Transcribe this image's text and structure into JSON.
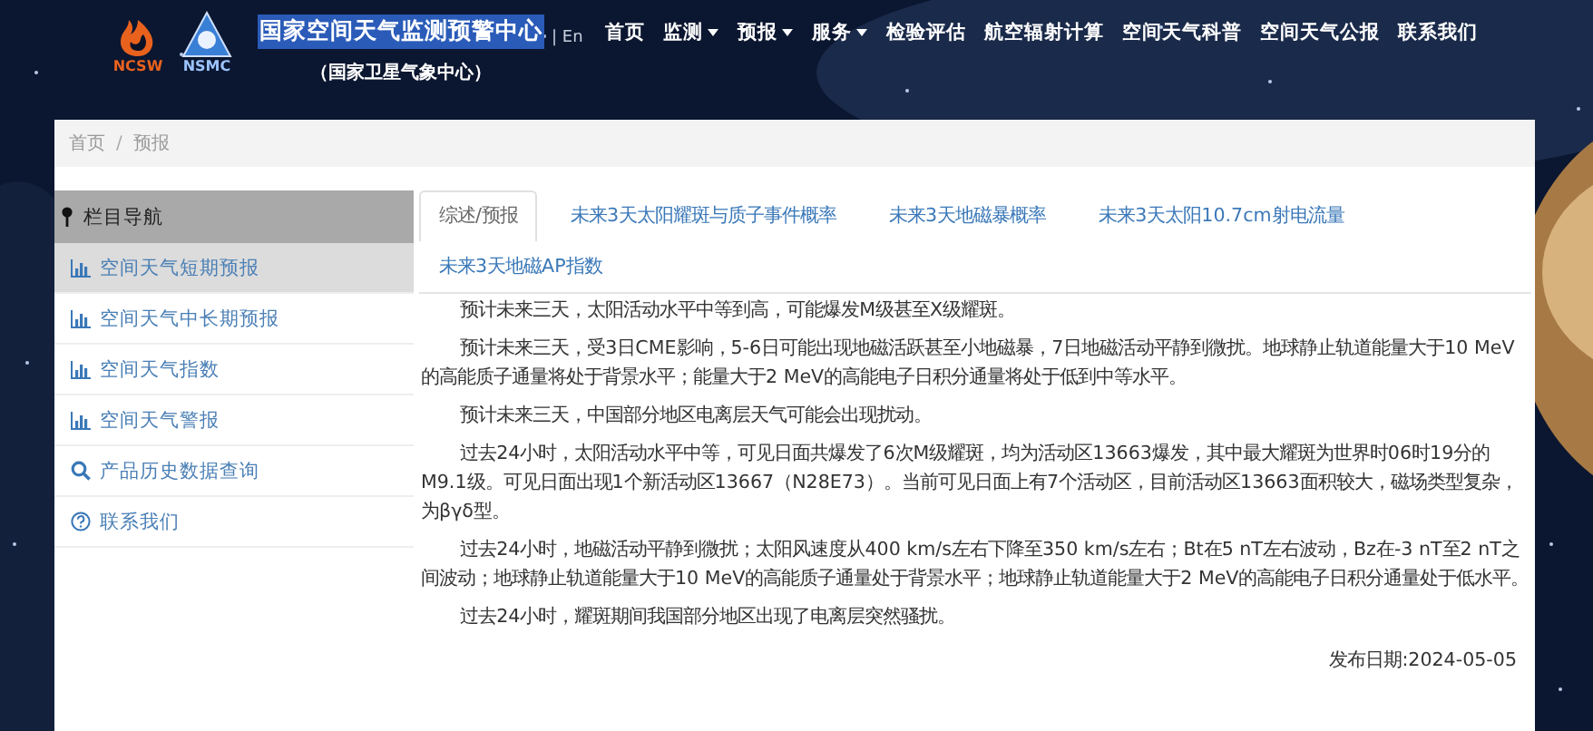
{
  "header": {
    "logos": [
      {
        "kind": "ncsw",
        "label": "NCSW"
      },
      {
        "kind": "nsmc",
        "label": "NSMC"
      }
    ],
    "title": "国家空间天气监测预警中心",
    "subtitle": "（国家卫星气象中心）",
    "language": "| En",
    "nav": [
      {
        "label": "首页",
        "dropdown": false
      },
      {
        "label": "监测",
        "dropdown": true
      },
      {
        "label": "预报",
        "dropdown": true
      },
      {
        "label": "服务",
        "dropdown": true
      },
      {
        "label": "检验评估",
        "dropdown": false
      },
      {
        "label": "航空辐射计算",
        "dropdown": false
      },
      {
        "label": "空间天气科普",
        "dropdown": false
      },
      {
        "label": "空间天气公报",
        "dropdown": false
      },
      {
        "label": "联系我们",
        "dropdown": false
      }
    ]
  },
  "breadcrumb": {
    "separator": "/",
    "items": [
      "首页",
      "预报"
    ]
  },
  "sidebar": {
    "title": "栏目导航",
    "items": [
      {
        "label": "空间天气短期预报",
        "kind": "chart",
        "selected": true
      },
      {
        "label": "空间天气中长期预报",
        "kind": "chart",
        "selected": false
      },
      {
        "label": "空间天气指数",
        "kind": "chart",
        "selected": false
      },
      {
        "label": "空间天气警报",
        "kind": "chart",
        "selected": false
      },
      {
        "label": "产品历史数据查询",
        "kind": "search",
        "selected": false
      },
      {
        "label": "联系我们",
        "kind": "help",
        "selected": false
      }
    ]
  },
  "tabs": [
    {
      "label": "综述/预报",
      "selected": true
    },
    {
      "label": "未来3天太阳耀斑与质子事件概率",
      "selected": false
    },
    {
      "label": "未来3天地磁暴概率",
      "selected": false
    },
    {
      "label": "未来3天太阳10.7cm射电流量",
      "selected": false
    },
    {
      "label": "未来3天地磁AP指数",
      "selected": false
    }
  ],
  "paragraphs": [
    "预计未来三天，太阳活动水平中等到高，可能爆发M级甚至X级耀斑。",
    "预计未来三天，受3日CME影响，5-6日可能出现地磁活跃甚至小地磁暴，7日地磁活动平静到微扰。地球静止轨道能量大于10 MeV的高能质子通量将处于背景水平；能量大于2 MeV的高能电子日积分通量将处于低到中等水平。",
    "预计未来三天，中国部分地区电离层天气可能会出现扰动。",
    "过去24小时，太阳活动水平中等，可见日面共爆发了6次M级耀斑，均为活动区13663爆发，其中最大耀斑为世界时06时19分的M9.1级。可见日面出现1个新活动区13667（N28E73）。当前可见日面上有7个活动区，目前活动区13663面积较大，磁场类型复杂，为βγδ型。",
    "过去24小时，地磁活动平静到微扰；太阳风速度从400 km/s左右下降至350 km/s左右；Bt在5 nT左右波动，Bz在-3 nT至2 nT之间波动；地球静止轨道能量大于10 MeV的高能质子通量处于背景水平；地球静止轨道能量大于2 MeV的高能电子日积分通量处于低水平。",
    "过去24小时，耀斑期间我国部分地区出现了电离层突然骚扰。"
  ],
  "publish_date": "发布日期:2024-05-05"
}
